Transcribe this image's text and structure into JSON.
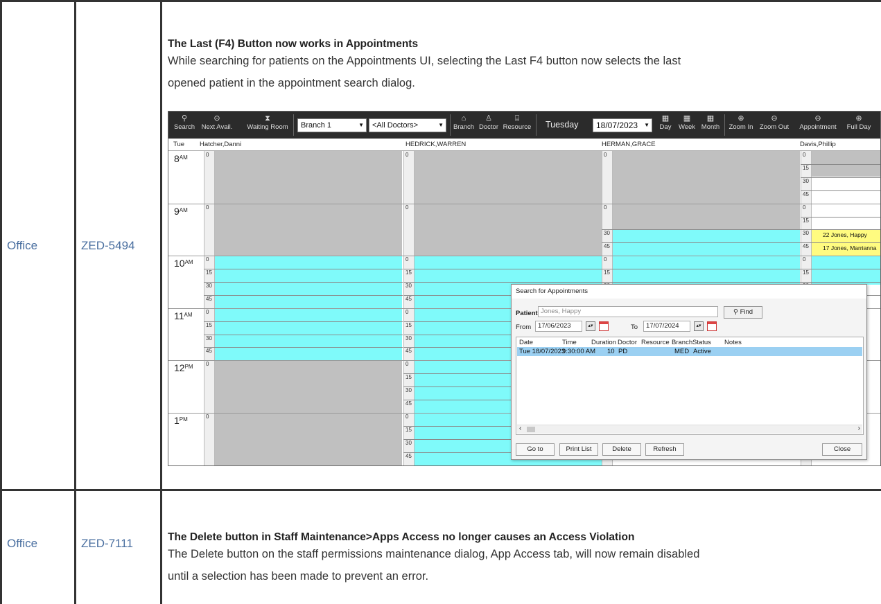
{
  "rows": [
    {
      "category": "Office",
      "id": "ZED-5494",
      "title": "The Last (F4) Button now works in Appointments",
      "body_lines": [
        "While searching for patients on the Appointments UI, selecting the Last F4 button now selects the last",
        "opened patient in the appointment search dialog."
      ]
    },
    {
      "category": "Office",
      "id": "ZED-7111",
      "title": "The Delete button in Staff Maintenance>Apps Access no longer causes an Access Violation",
      "body_lines": [
        "The Delete button on the staff permissions maintenance dialog, App Access tab, will now remain disabled",
        "until a selection has been made to prevent an error."
      ]
    }
  ],
  "toolbar": {
    "search": "Search",
    "next_avail": "Next Avail.",
    "waiting_room": "Waiting Room",
    "branch_select": "Branch 1",
    "doctor_select": "<All Doctors>",
    "branch": "Branch",
    "doctor": "Doctor",
    "resource": "Resource",
    "day_name": "Tuesday",
    "date": "18/07/2023",
    "day": "Day",
    "week": "Week",
    "month": "Month",
    "zoom_in": "Zoom In",
    "zoom_out": "Zoom Out",
    "appointment": "Appointment",
    "full_day": "Full Day"
  },
  "schedule": {
    "day_col": "Tue",
    "doctors": [
      "Hatcher,Danni",
      "HEDRICK,WARREN",
      "HERMAN,GRACE",
      "Davis,Phillip"
    ],
    "hours": [
      {
        "h": "8",
        "ap": "AM"
      },
      {
        "h": "9",
        "ap": "AM"
      },
      {
        "h": "10",
        "ap": "AM"
      },
      {
        "h": "11",
        "ap": "AM"
      },
      {
        "h": "12",
        "ap": "PM"
      },
      {
        "h": "1",
        "ap": "PM"
      }
    ],
    "appointments": [
      "22 Jones, Happy",
      "17 Jones, Marrianna"
    ]
  },
  "dialog": {
    "title": "Search for Appointments",
    "patient_label": "Patient",
    "patient_value": "Jones, Happy",
    "find": "Find",
    "from_label": "From",
    "from_value": "17/06/2023",
    "to_label": "To",
    "to_value": "17/07/2024",
    "columns": [
      "Date",
      "Time",
      "Duration",
      "Doctor",
      "Resource",
      "Branch",
      "Status",
      "Notes"
    ],
    "result": [
      "Tue 18/07/2023",
      "9:30:00 AM",
      "10",
      "PD",
      "",
      "MED",
      "Active",
      ""
    ],
    "buttons": {
      "goto": "Go to",
      "print": "Print List",
      "delete": "Delete",
      "refresh": "Refresh",
      "close": "Close"
    }
  }
}
